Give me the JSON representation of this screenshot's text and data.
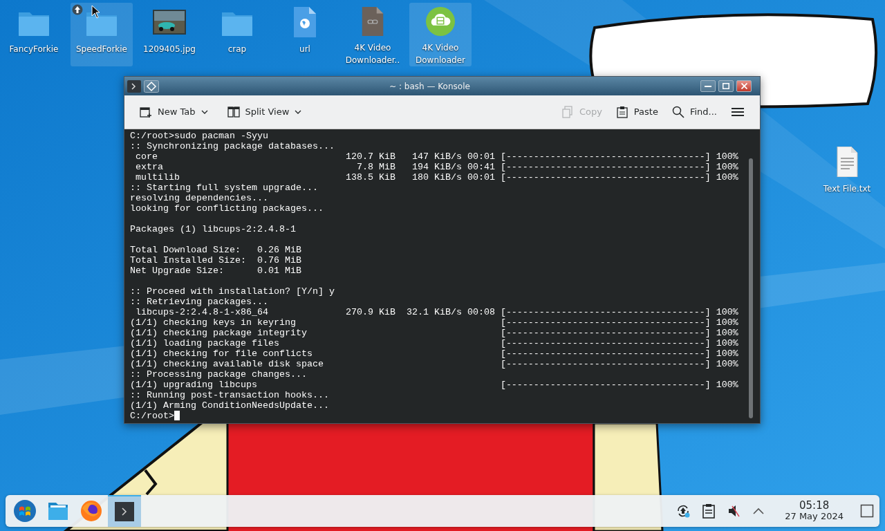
{
  "desktop_icons": [
    {
      "label": "FancyForkie",
      "kind": "folder",
      "highlighted": false
    },
    {
      "label": "SpeedForkie",
      "kind": "folder",
      "highlighted": true
    },
    {
      "label": "1209405.jpg",
      "highlighted": false
    },
    {
      "label": "crap",
      "kind": "folder",
      "highlighted": false
    },
    {
      "label": "url",
      "kind": "web",
      "highlighted": false
    },
    {
      "label": "4K Video Downloader..",
      "kind": "file",
      "highlighted": false
    },
    {
      "label": "4K Video Downloader",
      "kind": "app",
      "highlighted": true
    }
  ],
  "side_icons": [
    {
      "label": "Text File.txt",
      "kind": "text",
      "highlighted": false
    }
  ],
  "window": {
    "title": "~ : bash — Konsole",
    "toolbar_left": [
      {
        "label": "New Tab",
        "kind": "new-tab",
        "dropdown": true
      },
      {
        "label": "Split View",
        "kind": "split-view",
        "dropdown": true
      }
    ],
    "toolbar_right": [
      {
        "label": "Copy",
        "kind": "copy",
        "disabled": true
      },
      {
        "label": "Paste",
        "kind": "paste",
        "disabled": false
      },
      {
        "label": "Find...",
        "kind": "find",
        "disabled": false
      },
      {
        "kind": "menu",
        "disabled": false
      }
    ],
    "terminal": {
      "blocks": [
        [
          "C:/root>sudo pacman -Syyu",
          ":: Synchronizing package databases...",
          " core                                  120.7 KiB   147 KiB/s 00:01 [------------------------------------] 100%",
          " extra                                   7.8 MiB   194 KiB/s 00:41 [------------------------------------] 100%",
          " multilib                              138.5 KiB   180 KiB/s 00:01 [------------------------------------] 100%",
          ":: Starting full system upgrade...",
          "resolving dependencies...",
          "looking for conflicting packages..."
        ],
        [
          "Packages (1) libcups-2:2.4.8-1"
        ],
        [
          "Total Download Size:   0.26 MiB",
          "Total Installed Size:  0.76 MiB",
          "Net Upgrade Size:      0.01 MiB"
        ],
        [
          ":: Proceed with installation? [Y/n] y",
          ":: Retrieving packages...",
          " libcups-2:2.4.8-1-x86_64              270.9 KiB  32.1 KiB/s 00:08 [------------------------------------] 100%",
          "(1/1) checking keys in keyring                                     [------------------------------------] 100%",
          "(1/1) checking package integrity                                   [------------------------------------] 100%",
          "(1/1) loading package files                                        [------------------------------------] 100%",
          "(1/1) checking for file conflicts                                  [------------------------------------] 100%",
          "(1/1) checking available disk space                                [------------------------------------] 100%",
          ":: Processing package changes...",
          "(1/1) upgrading libcups                                            [------------------------------------] 100%",
          ":: Running post-transaction hooks...",
          "(1/1) Arming ConditionNeedsUpdate..."
        ]
      ],
      "prompt": "C:/root>",
      "cursor": true
    }
  },
  "taskbar": {
    "tasks": [
      {
        "kind": "start",
        "active": false
      },
      {
        "kind": "files",
        "active": false
      },
      {
        "kind": "browser",
        "active": false
      },
      {
        "kind": "terminal",
        "active": true
      }
    ],
    "tray": [
      {
        "kind": "update"
      },
      {
        "kind": "clipboard"
      },
      {
        "kind": "muted"
      },
      {
        "kind": "expand"
      }
    ],
    "clock": {
      "time": "05:18",
      "date": "27 May 2024"
    }
  }
}
